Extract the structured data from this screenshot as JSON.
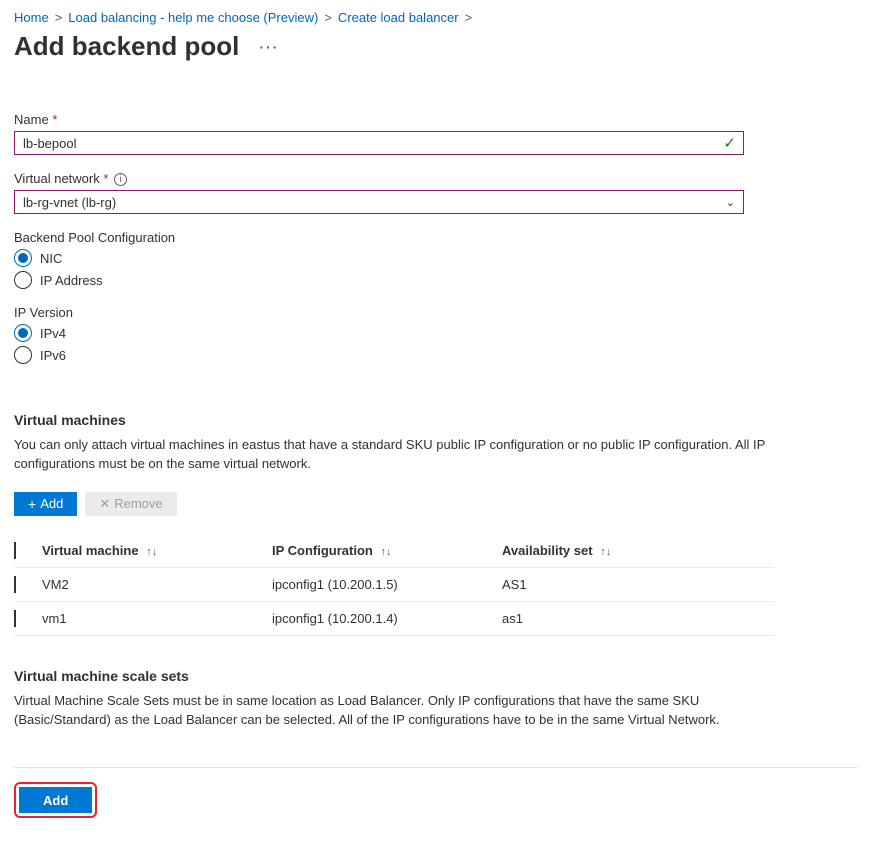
{
  "breadcrumb": {
    "home": "Home",
    "lb_choose": "Load balancing - help me choose (Preview)",
    "create_lb": "Create load balancer"
  },
  "page_title": "Add backend pool",
  "dots": "···",
  "name": {
    "label": "Name",
    "value": "lb-bepool"
  },
  "vnet": {
    "label": "Virtual network",
    "value": "lb-rg-vnet (lb-rg)"
  },
  "backend_config": {
    "label": "Backend Pool Configuration",
    "nic": "NIC",
    "ip": "IP Address"
  },
  "ip_version": {
    "label": "IP Version",
    "v4": "IPv4",
    "v6": "IPv6"
  },
  "vm_section": {
    "title": "Virtual machines",
    "desc": "You can only attach virtual machines in eastus that have a standard SKU public IP configuration or no public IP configuration. All IP configurations must be on the same virtual network.",
    "add": "Add",
    "remove": "Remove",
    "col_vm": "Virtual machine",
    "col_ip": "IP Configuration",
    "col_as": "Availability set",
    "rows": [
      {
        "name": "VM2",
        "ip": "ipconfig1 (10.200.1.5)",
        "as": "AS1"
      },
      {
        "name": "vm1",
        "ip": "ipconfig1 (10.200.1.4)",
        "as": "as1"
      }
    ]
  },
  "vmss_section": {
    "title": "Virtual machine scale sets",
    "desc": "Virtual Machine Scale Sets must be in same location as Load Balancer. Only IP configurations that have the same SKU (Basic/Standard) as the Load Balancer can be selected. All of the IP configurations have to be in the same Virtual Network."
  },
  "footer": {
    "add": "Add"
  }
}
